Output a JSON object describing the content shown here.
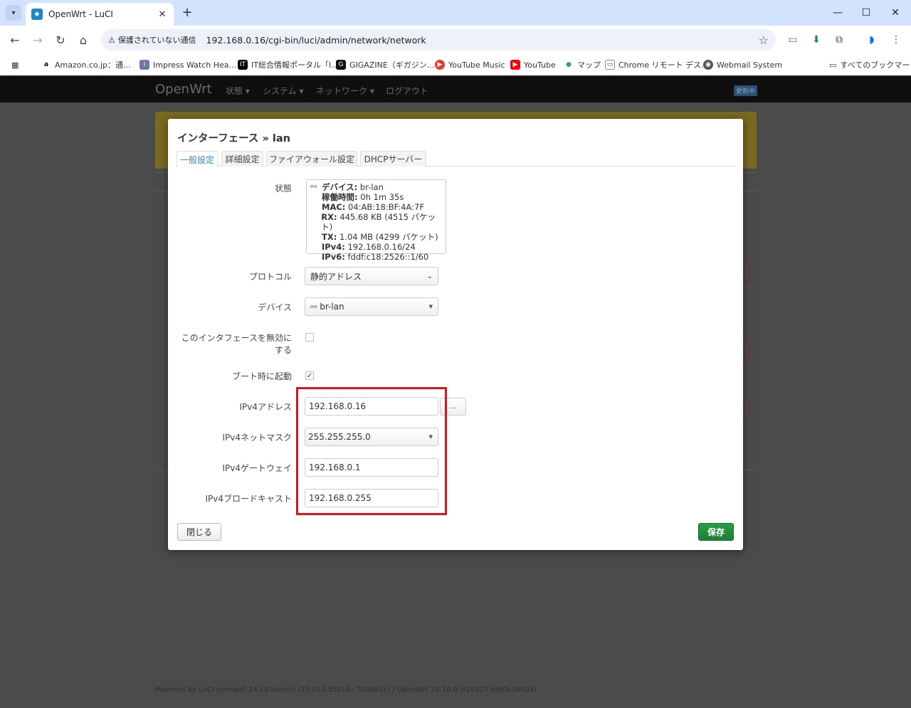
{
  "browser": {
    "tab_title": "OpenWrt - LuCI",
    "tab_close": "✕",
    "new_tab": "+",
    "security_label": "保護されていない通信",
    "url": "192.168.0.16/cgi-bin/luci/admin/network/network",
    "bookmarks": [
      "Amazon.co.jp：通...",
      "Impress Watch Hea...",
      "IT総合情報ポータル「I...",
      "GIGAZINE（ギガジン...",
      "YouTube Music",
      "YouTube",
      "マップ",
      "Chrome リモート デス...",
      "Webmail System"
    ],
    "all_bookmarks": "すべてのブックマーク"
  },
  "luci": {
    "brand": "OpenWrt",
    "menu": [
      "状態 ▾",
      "システム ▾",
      "ネットワーク ▾",
      "ログアウト"
    ],
    "badge": "更新中",
    "footer": "Powered by LuCI openwrt-24.10 branch (25.014.55016~7046a1c) / OpenWrt 24.10.0 (r28427-6df0e3d02a)"
  },
  "modal": {
    "title": "インターフェース » lan",
    "tabs": [
      "一般設定",
      "詳細設定",
      "ファイアウォール設定",
      "DHCPサーバー"
    ],
    "status_label": "状態",
    "status": {
      "device_key": "デバイス:",
      "device_val": "br-lan",
      "uptime_key": "稼働時間:",
      "uptime_val": "0h 1m 35s",
      "mac_key": "MAC:",
      "mac_val": "04:AB:18:BF:4A:7F",
      "rx_key": "RX:",
      "rx_val": "445.68 KB (4515 パケット)",
      "tx_key": "TX:",
      "tx_val": "1.04 MB (4299 パケット)",
      "ipv4_key": "IPv4:",
      "ipv4_val": "192.168.0.16/24",
      "ipv6_key": "IPv6:",
      "ipv6_val": "fddf:c18:2526::1/60"
    },
    "protocol_label": "プロトコル",
    "protocol_value": "静的アドレス",
    "device_label": "デバイス",
    "device_value": "br-lan",
    "disable_label_1": "このインタフェースを無効に",
    "disable_label_2": "する",
    "boot_label": "ブート時に起動",
    "ipv4_addr_label": "IPv4アドレス",
    "ipv4_addr_value": "192.168.0.16",
    "dots": "...",
    "netmask_label": "IPv4ネットマスク",
    "netmask_value": "255.255.255.0",
    "gateway_label": "IPv4ゲートウェイ",
    "gateway_value": "192.168.0.1",
    "broadcast_label": "IPv4ブロードキャスト",
    "broadcast_value": "192.168.0.255",
    "close_button": "閉じる",
    "save_button": "保存"
  },
  "colors": {
    "highlight": "#d9161f",
    "save": "#1d7f36",
    "active_tab": "#3a87c8"
  }
}
